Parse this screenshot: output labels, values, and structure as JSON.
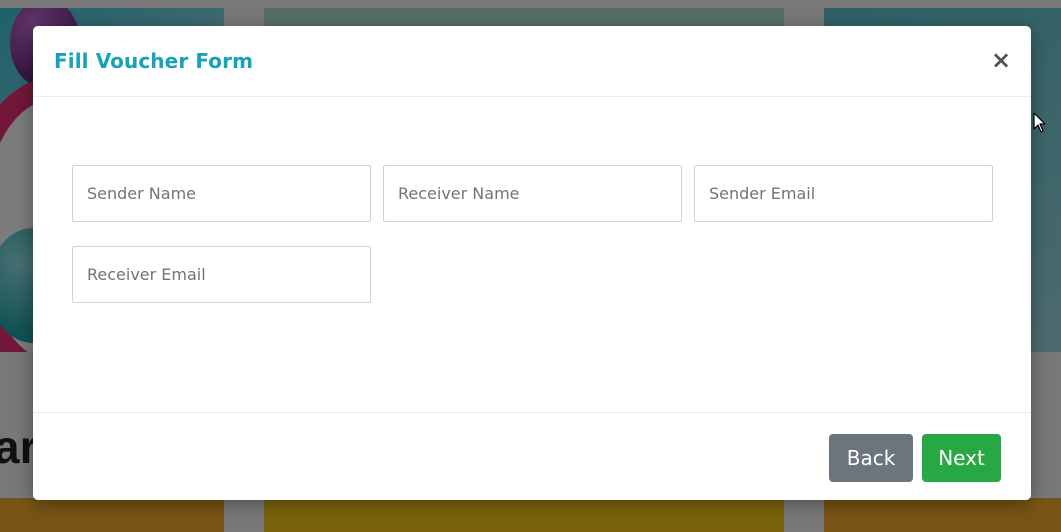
{
  "modal": {
    "title": "Fill Voucher Form",
    "close_label": "×",
    "fields": [
      {
        "placeholder": "Sender Name",
        "value": ""
      },
      {
        "placeholder": "Receiver Name",
        "value": ""
      },
      {
        "placeholder": "Sender Email",
        "value": ""
      },
      {
        "placeholder": "Receiver Email",
        "value": ""
      }
    ],
    "back_label": "Back",
    "next_label": "Next"
  },
  "background": {
    "partial_heading": "ar"
  },
  "colors": {
    "title": "#17a2b8",
    "back_button": "#6c757d",
    "next_button": "#28a745"
  },
  "icons": {
    "close": "close-icon",
    "cursor": "mouse-pointer-icon"
  }
}
